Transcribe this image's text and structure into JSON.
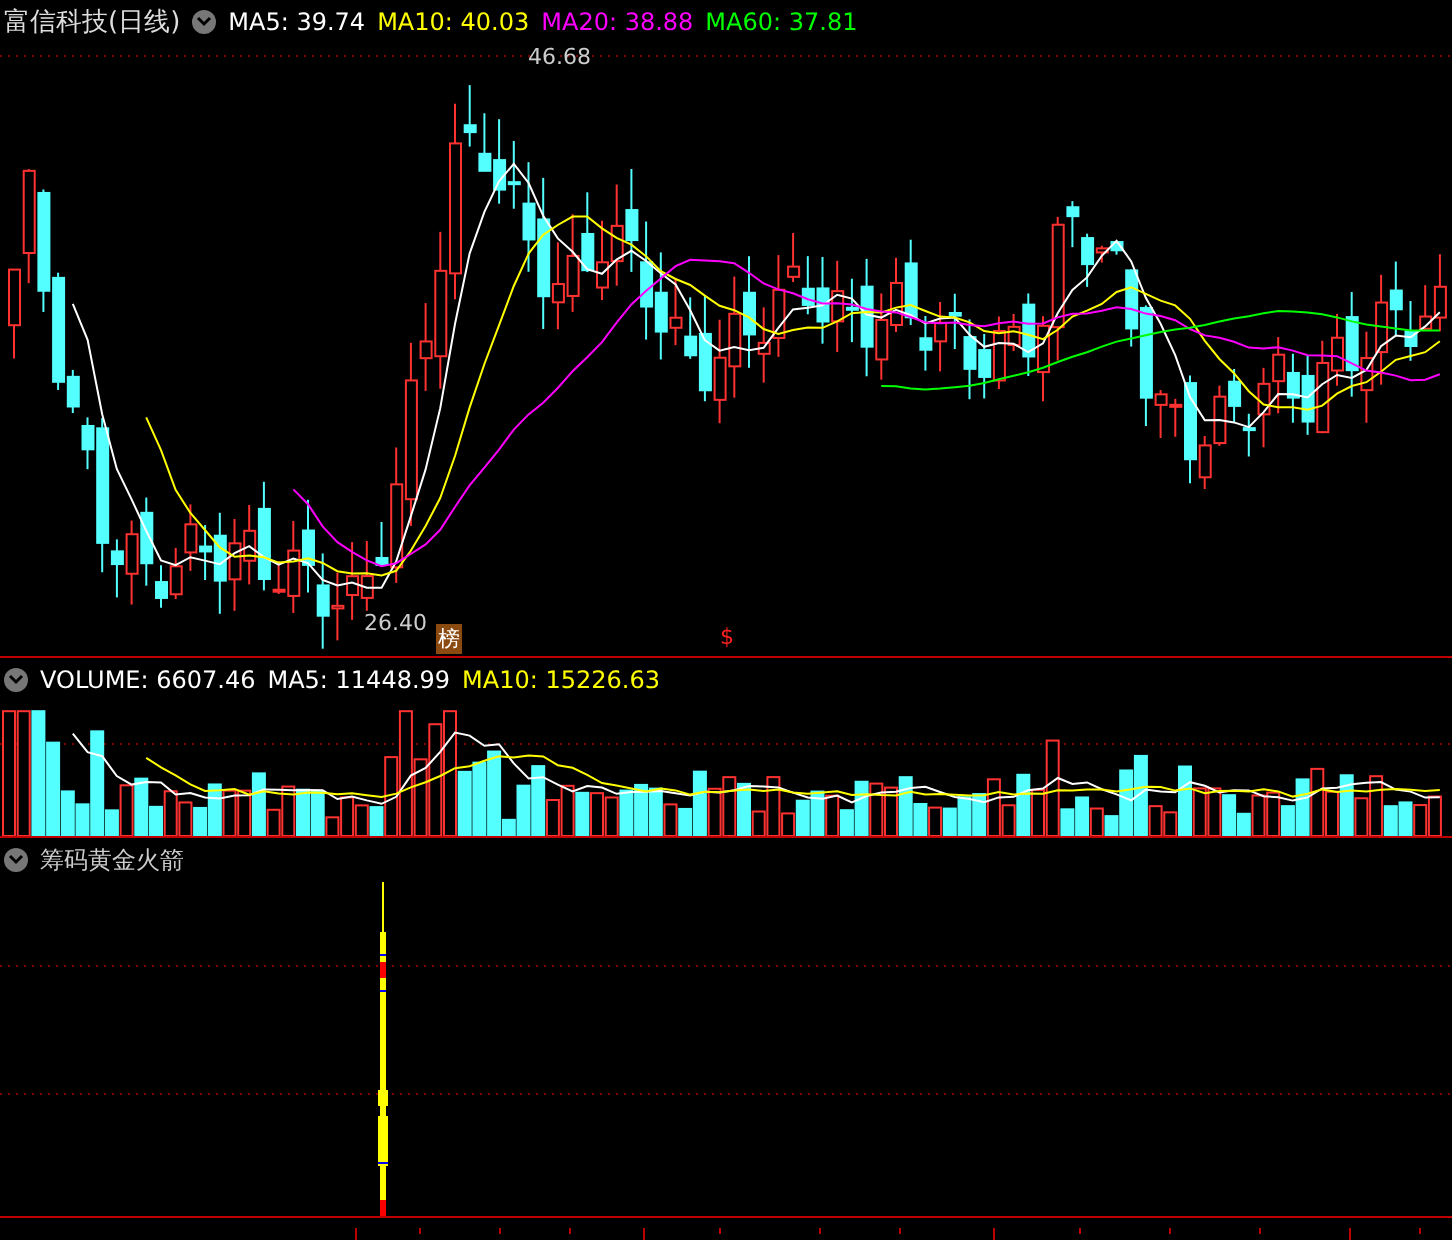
{
  "title": "富信科技(日线)",
  "indicators": [
    {
      "label": "MA5: 39.74",
      "color": "#ffffff"
    },
    {
      "label": "MA10: 40.03",
      "color": "#ffff00"
    },
    {
      "label": "MA20: 38.88",
      "color": "#ff00ff"
    },
    {
      "label": "MA60: 37.81",
      "color": "#00ff00"
    }
  ],
  "price_labels": {
    "high": "46.68",
    "low": "26.40"
  },
  "marker_badge": "榜",
  "marker_symbol": "$",
  "volume": {
    "label": "VOLUME: 6607.46",
    "indicators": [
      {
        "label": "MA5: 11448.99",
        "color": "#ffffff"
      },
      {
        "label": "MA10: 15226.63",
        "color": "#ffff00"
      }
    ]
  },
  "signal_panel": {
    "title": "筹码黄金火箭"
  }
}
